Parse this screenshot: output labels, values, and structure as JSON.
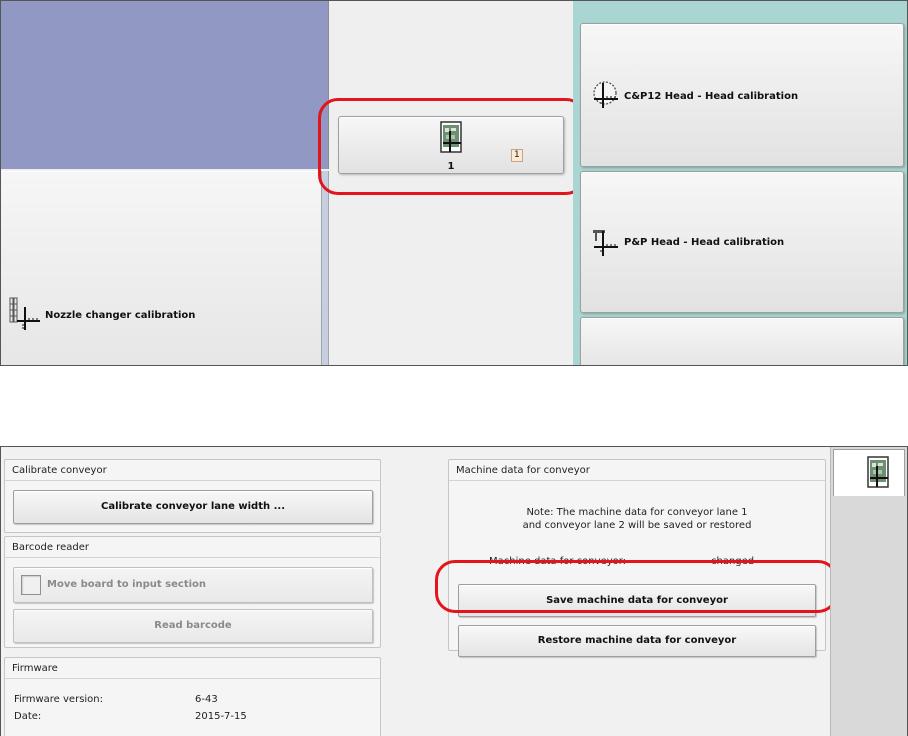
{
  "top_screen": {
    "lane_button": {
      "number": "1",
      "badge": "1",
      "icon": "conveyor-lane-icon"
    },
    "cp12_head_button": {
      "label": "C&P12 Head - Head calibration",
      "icon": "cp12-head-calibration-icon"
    },
    "pp_head_button": {
      "label": "P&P Head - Head calibration",
      "icon": "pp-head-calibration-icon"
    },
    "nozzle_button": {
      "label": "Nozzle changer calibration",
      "icon": "nozzle-changer-icon"
    },
    "colors": {
      "left_panel": "#9198c4",
      "right_panel": "#a9d6d2",
      "highlight": "#e3141b"
    }
  },
  "bottom_screen": {
    "calibrate_conveyor": {
      "title": "Calibrate conveyor",
      "calibrate_button": "Calibrate conveyor lane width ..."
    },
    "barcode_reader": {
      "title": "Barcode reader",
      "move_board_label": "Move board to input section",
      "read_barcode_button": "Read barcode"
    },
    "firmware": {
      "title": "Firmware",
      "version_label": "Firmware version:",
      "version_value": "6-43",
      "date_label": "Date:",
      "date_value": "2015-7-15"
    },
    "machine_data": {
      "title": "Machine data for conveyor",
      "note_line1": "Note: The machine data for conveyor lane 1",
      "note_line2": "and conveyor lane 2 will be saved or restored",
      "status_label": "Machine data for conveyor:",
      "status_value": "changed",
      "save_button": "Save machine data for conveyor",
      "restore_button": "Restore machine data for conveyor"
    },
    "side_tab": {
      "icon": "conveyor-lane-icon"
    }
  }
}
